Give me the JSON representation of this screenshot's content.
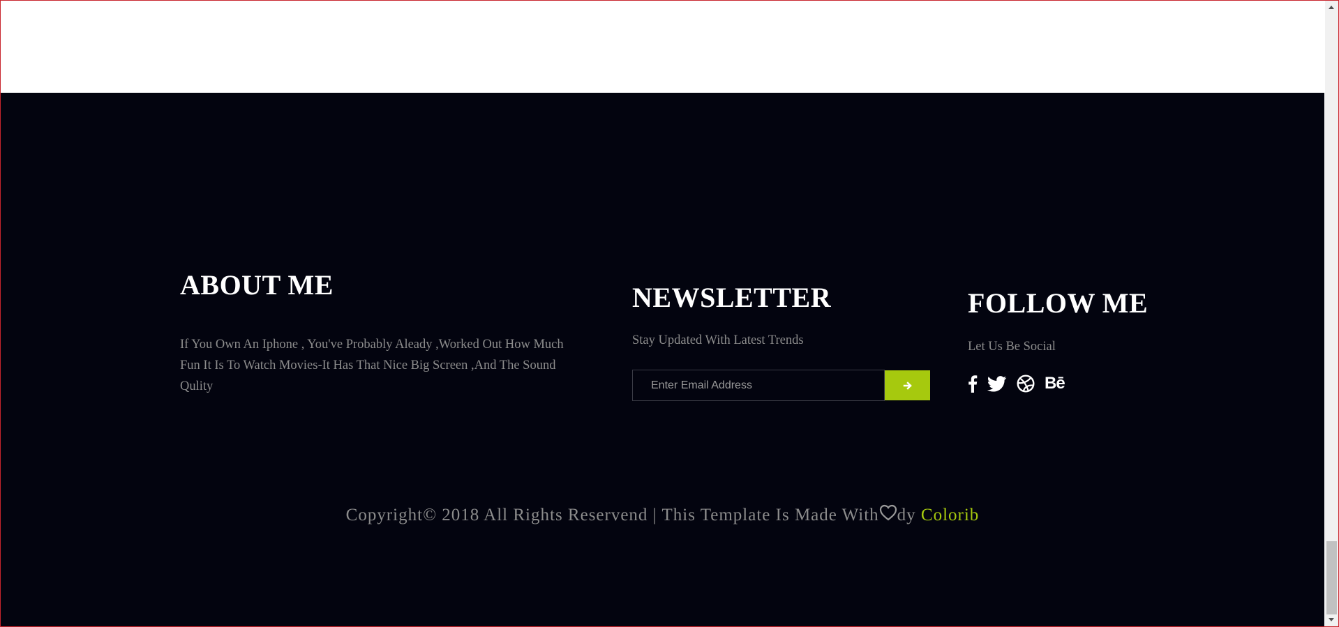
{
  "about": {
    "title": "ABOUT ME",
    "text": "If You Own An Iphone , You've Probably Aleady ,Worked Out How Much Fun It Is To Watch Movies-It Has That Nice Big Screen ,And The Sound Qulity"
  },
  "newsletter": {
    "title": "NEWSLETTER",
    "subtitle": "Stay Updated With Latest Trends",
    "email_placeholder": "Enter Email Address",
    "submit_icon": "arrow-right-icon"
  },
  "follow": {
    "title": "FOLLOW ME",
    "subtitle": "Let Us Be Social",
    "icons": [
      "facebook-icon",
      "twitter-icon",
      "dribbble-icon",
      "behance-icon"
    ],
    "behance_label": "Bē"
  },
  "copyright": {
    "prefix": "Copyright© 2018 All Rights Reservend | This Template Is Made With",
    "middle": "dy ",
    "link": "Colorib"
  },
  "colors": {
    "footer_bg": "#03040f",
    "accent": "#a6c90e",
    "muted_text": "#8c8c8c",
    "heading": "#ffffff"
  }
}
